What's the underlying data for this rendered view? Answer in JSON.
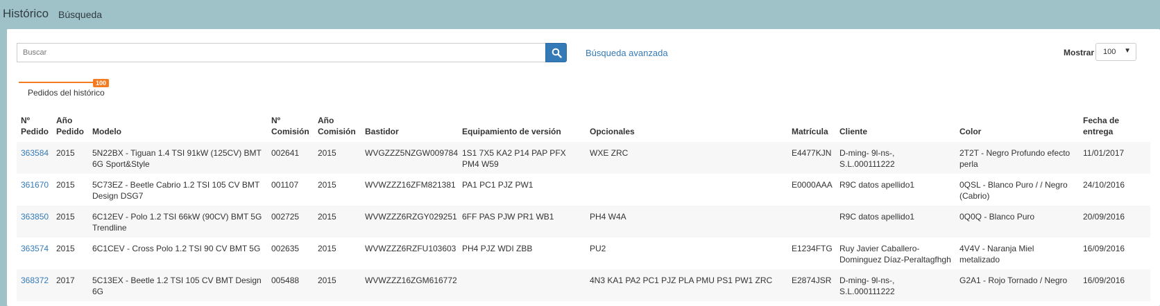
{
  "header": {
    "title": "Histórico",
    "subtitle": "Búsqueda"
  },
  "search": {
    "placeholder": "Buscar",
    "advanced_link": "Búsqueda avanzada"
  },
  "pager": {
    "mostrar_label": "Mostrar",
    "page_size": "100"
  },
  "tab": {
    "label": "Pedidos del histórico",
    "badge": "100"
  },
  "table": {
    "headers": {
      "pedido": "Nº Pedido",
      "anio_pedido": "Año Pedido",
      "modelo": "Modelo",
      "comision": "Nº Comisión",
      "anio_comision": "Año Comisión",
      "bastidor": "Bastidor",
      "equipamiento": "Equipamiento de versión",
      "opcionales": "Opcionales",
      "matricula": "Matrícula",
      "cliente": "Cliente",
      "color": "Color",
      "entrega": "Fecha de entrega"
    },
    "rows": [
      [
        "363584",
        "2015",
        "5N22BX - Tiguan 1.4 TSI 91kW (125CV) BMT 6G Sport&Style",
        "002641",
        "2015",
        "WVGZZZ5NZGW009784",
        "1S1 7X5 KA2 P14 PAP PFX PM4 W59",
        "WXE ZRC",
        "E4477KJN",
        "D-ming- 9l-ns-, S.L.000111222",
        "2T2T - Negro Profundo efecto perla",
        "11/01/2017"
      ],
      [
        "361670",
        "2015",
        "5C73EZ - Beetle Cabrio 1.2 TSI 105 CV BMT Design DSG7",
        "001107",
        "2015",
        "WVWZZZ16ZFM821381",
        "PA1 PC1 PJZ PW1",
        "",
        "E0000AAA",
        "R9C datos apellido1",
        "0QSL - Blanco Puro / / Negro (Cabrio)",
        "24/10/2016"
      ],
      [
        "363850",
        "2015",
        "6C12EV - Polo 1.2 TSI 66kW (90CV) BMT 5G Trendline",
        "002725",
        "2015",
        "WVWZZZ6RZGY029251",
        "6FF PAS PJW PR1 WB1",
        "PH4 W4A",
        "",
        "R9C datos apellido1",
        "0Q0Q - Blanco Puro",
        "20/09/2016"
      ],
      [
        "363574",
        "2015",
        "6C1CEV - Cross Polo 1.2 TSI 90 CV BMT 5G",
        "002635",
        "2015",
        "WVWZZZ6RZFU103603",
        "PH4 PJZ WDI ZBB",
        "PU2",
        "E1234FTG",
        "Ruy Javier Caballero-Dominguez Díaz-Peraltagfhgh",
        "4V4V - Naranja Miel metalizado",
        "16/09/2016"
      ],
      [
        "368372",
        "2017",
        "5C13EX - Beetle 1.2 TSI 105 CV BMT Design 6G",
        "005488",
        "2015",
        "WVWZZZ16ZGM616772",
        "",
        "4N3 KA1 PA2 PC1 PJZ PLA PMU PS1 PW1 ZRC",
        "E2874JSR",
        "D-ming- 9l-ns-, S.L.000111222",
        "G2A1 - Rojo Tornado / Negro",
        "16/09/2016"
      ]
    ]
  }
}
